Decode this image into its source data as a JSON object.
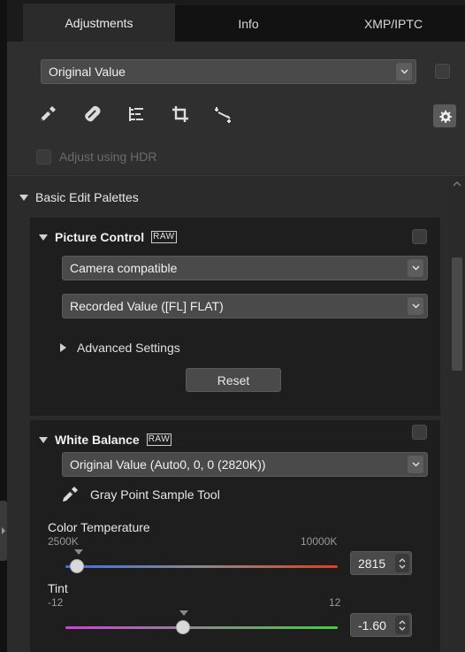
{
  "tabs": [
    "Adjustments",
    "Info",
    "XMP/IPTC"
  ],
  "top_select": {
    "value": "Original Value"
  },
  "toolbar": {
    "icons": [
      "eyedropper-icon",
      "retouch-brush-icon",
      "straighten-icon",
      "crop-icon",
      "perspective-icon",
      "gear-icon"
    ]
  },
  "hdr": {
    "label": "Adjust using HDR",
    "checked": false
  },
  "basic_edit": {
    "title": "Basic Edit Palettes"
  },
  "picture_control": {
    "title": "Picture Control",
    "badge": "RAW",
    "select1": "Camera compatible",
    "select2": "Recorded Value ([FL] FLAT)",
    "advanced": "Advanced Settings",
    "reset": "Reset"
  },
  "white_balance": {
    "title": "White Balance",
    "badge": "RAW",
    "select": "Original Value (Auto0, 0, 0 (2820K))",
    "gray_point": "Gray Point Sample Tool",
    "color_temp": {
      "label": "Color Temperature",
      "min": "2500K",
      "max": "10000K",
      "value": "2815",
      "min_num": 2500,
      "max_num": 10000,
      "num": 2815
    },
    "tint": {
      "label": "Tint",
      "min": "-12",
      "max": "12",
      "value": "-1.60",
      "min_num": -12,
      "max_num": 12,
      "num": -1.6
    }
  },
  "colors": {
    "panel": "#2b2b2b",
    "palette": "#1e1e1e",
    "control": "#4a4a4a"
  }
}
